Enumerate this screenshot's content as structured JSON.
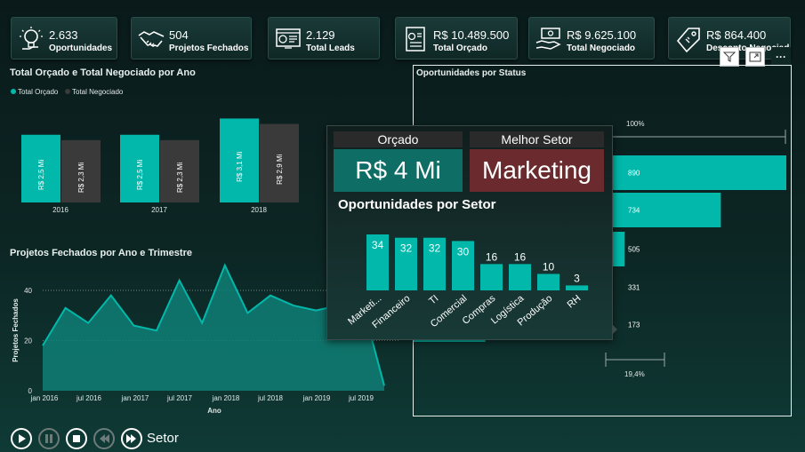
{
  "kpis": [
    {
      "value": "2.633",
      "label": "Oportunidades",
      "icon": "lightbulb-icon"
    },
    {
      "value": "504",
      "label": "Projetos Fechados",
      "icon": "handshake-icon"
    },
    {
      "value": "2.129",
      "label": "Total Leads",
      "icon": "dashboard-icon"
    },
    {
      "value": "R$ 10.489.500",
      "label": "Total Orçado",
      "icon": "budget-icon"
    },
    {
      "value": "R$ 9.625.100",
      "label": "Total Negociado",
      "icon": "money-hand-icon"
    },
    {
      "value": "R$ 864.400",
      "label": "Desconto Negociado",
      "icon": "price-tag-icon"
    }
  ],
  "bar_panel": {
    "title": "Total Orçado e Total Negociado por Ano",
    "legend": [
      "Total Orçado",
      "Total Negociado"
    ]
  },
  "area_panel": {
    "title": "Projetos Fechados por Ano e Trimestre",
    "ylabel": "Projetos Fechados",
    "xlabel": "Ano"
  },
  "funnel_panel": {
    "title": "Oportunidades por Status",
    "top_label": "100%",
    "bottom_label": "19,4%"
  },
  "tooltip": {
    "orcado_title": "Orçado",
    "orcado_value": "R$ 4 Mi",
    "setor_title": "Melhor Setor",
    "setor_value": "Marketing",
    "chart_title": "Oportunidades por Setor"
  },
  "player": {
    "label": "Setor"
  },
  "colors": {
    "teal": "#01b8aa",
    "dark_bar": "#3a3a3a",
    "marketing": "#6b2a2e",
    "orcado_box": "#0e6e66"
  },
  "chart_data": [
    {
      "type": "bar",
      "title": "Total Orçado e Total Negociado por Ano",
      "categories": [
        "2016",
        "2017",
        "2018"
      ],
      "series": [
        {
          "name": "Total Orçado",
          "values": [
            2.5,
            2.5,
            3.1
          ],
          "labels": [
            "R$ 2,5 Mi",
            "R$ 2,5 Mi",
            "R$ 3,1 Mi"
          ]
        },
        {
          "name": "Total Negociado",
          "values": [
            2.3,
            2.3,
            2.9
          ],
          "labels": [
            "R$ 2,3 Mi",
            "R$ 2,3 Mi",
            "R$ 2,9 Mi"
          ]
        }
      ],
      "ylim": [
        0,
        3.5
      ]
    },
    {
      "type": "area",
      "title": "Projetos Fechados por Ano e Trimestre",
      "xlabel": "Ano",
      "ylabel": "Projetos Fechados",
      "x_ticks": [
        "jan 2016",
        "jul 2016",
        "jan 2017",
        "jul 2017",
        "jan 2018",
        "jul 2018",
        "jan 2019",
        "jul 2019"
      ],
      "y_ticks": [
        0,
        20,
        40
      ],
      "ylim": [
        0,
        50
      ],
      "values": [
        18,
        33,
        27,
        38,
        26,
        24,
        44,
        27,
        50,
        31,
        38,
        34,
        32,
        34,
        36,
        2
      ]
    },
    {
      "type": "funnel",
      "title": "Oportunidades por Status",
      "values": [
        890,
        734,
        505,
        331,
        173
      ]
    },
    {
      "type": "bar",
      "title": "Oportunidades por Setor",
      "categories": [
        "Marketi...",
        "Financeiro",
        "TI",
        "Comercial",
        "Compras",
        "Logística",
        "Produção",
        "RH"
      ],
      "values": [
        34,
        32,
        32,
        30,
        16,
        16,
        10,
        3
      ],
      "ylim": [
        0,
        34
      ]
    }
  ]
}
